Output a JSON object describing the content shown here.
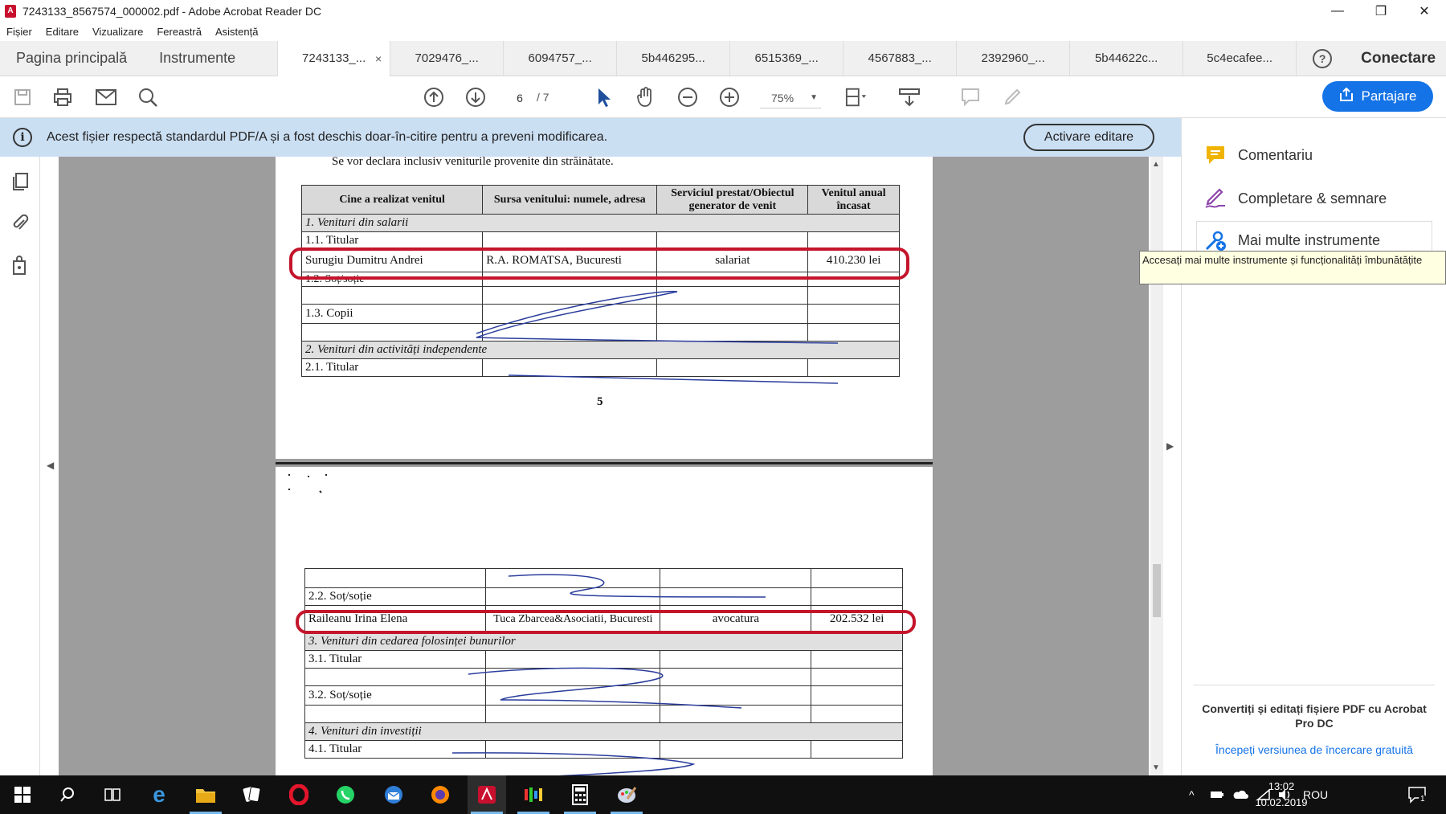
{
  "window": {
    "title": "7243133_8567574_000002.pdf - Adobe Acrobat Reader DC",
    "app_icon_glyph": "A",
    "minimize": "—",
    "restore": "❐",
    "close": "✕"
  },
  "menu": [
    "Fișier",
    "Editare",
    "Vizualizare",
    "Fereastră",
    "Asistență"
  ],
  "tabs": {
    "home": "Pagina principală",
    "tools": "Instrumente",
    "documents": [
      "7243133_...",
      "7029476_...",
      "6094757_...",
      "5b446295...",
      "6515369_...",
      "4567883_...",
      "2392960_...",
      "5b44622c...",
      "5c4ecafee..."
    ],
    "active_index": 0,
    "close_glyph": "×",
    "help": "?",
    "connect": "Conectare"
  },
  "toolbar": {
    "page_current": "6",
    "page_total": "/ 7",
    "zoom": "75%",
    "share_label": "Partajare",
    "icons": [
      "save-icon",
      "print-icon",
      "email-icon",
      "search-icon",
      "prev-page-icon",
      "next-page-icon",
      "select-tool-icon",
      "hand-tool-icon",
      "zoom-out-icon",
      "zoom-in-icon",
      "fit-page-icon",
      "scroll-mode-icon",
      "comment-icon",
      "highlight-icon"
    ]
  },
  "infobar": {
    "message": "Acest fișier respectă standardul PDF/A și a fost deschis doar-în-citire pentru a preveni modificarea.",
    "button": "Activare editare"
  },
  "document": {
    "page1": {
      "intro": "Se vor declara inclusiv veniturile provenite din străinătate.",
      "headers": [
        "Cine a realizat venitul",
        "Sursa venitului: numele, adresa",
        "Serviciul prestat/Obiectul generator de venit",
        "Venitul anual încasat"
      ],
      "rows": [
        {
          "type": "section",
          "text": "1. Venituri din salarii"
        },
        {
          "type": "row",
          "cells": [
            "1.1. Titular",
            "",
            "",
            ""
          ]
        },
        {
          "type": "row",
          "cells": [
            "Surugiu Dumitru Andrei",
            "R.A. ROMATSA, Bucuresti",
            "salariat",
            "410.230 lei"
          ]
        },
        {
          "type": "row",
          "cells": [
            "1.2. Soț/soție",
            "",
            "",
            ""
          ]
        },
        {
          "type": "row",
          "cells": [
            "",
            "",
            "",
            ""
          ]
        },
        {
          "type": "row",
          "cells": [
            "1.3. Copii",
            "",
            "",
            ""
          ]
        },
        {
          "type": "row",
          "cells": [
            "",
            "",
            "",
            ""
          ]
        },
        {
          "type": "section",
          "text": "2. Venituri din activități independente"
        },
        {
          "type": "row",
          "cells": [
            "2.1. Titular",
            "",
            "",
            ""
          ]
        }
      ],
      "page_number": "5"
    },
    "page2": {
      "rows": [
        {
          "type": "row",
          "cells": [
            "",
            "",
            "",
            ""
          ]
        },
        {
          "type": "row",
          "cells": [
            "2.2. Soț/soție",
            "",
            "",
            ""
          ]
        },
        {
          "type": "row",
          "cells": [
            "Raileanu Irina Elena",
            "Tuca Zbarcea&Asociatii, Bucuresti",
            "avocatura",
            "202.532 lei"
          ]
        },
        {
          "type": "section",
          "text": "3. Venituri din cedarea folosinței bunurilor"
        },
        {
          "type": "row",
          "cells": [
            "3.1. Titular",
            "",
            "",
            ""
          ]
        },
        {
          "type": "row",
          "cells": [
            "",
            "",
            "",
            ""
          ]
        },
        {
          "type": "row",
          "cells": [
            "3.2. Soț/soție",
            "",
            "",
            ""
          ]
        },
        {
          "type": "row",
          "cells": [
            "",
            "",
            "",
            ""
          ]
        },
        {
          "type": "section",
          "text": "4. Venituri din investiții"
        },
        {
          "type": "row",
          "cells": [
            "4.1. Titular",
            "",
            "",
            ""
          ]
        }
      ]
    }
  },
  "right_panel": {
    "items": [
      {
        "label": "Comentariu",
        "icon": "comment-icon",
        "color": "#f0b400"
      },
      {
        "label": "Completare & semnare",
        "icon": "fill-sign-icon",
        "color": "#8e44ad"
      },
      {
        "label": "Mai multe instrumente",
        "icon": "more-tools-icon",
        "color": "#1473e6"
      }
    ],
    "tooltip": "Accesați mai multe instrumente și funcționalități îmbunătățite",
    "promo": "Convertiți și editați fișiere PDF cu Acrobat Pro DC",
    "promo_link": "Începeți versiunea de încercare gratuită"
  },
  "taskbar": {
    "apps": [
      "windows-start-icon",
      "search-icon",
      "task-view-icon",
      "edge-icon",
      "file-explorer-icon",
      "solitaire-icon",
      "opera-icon",
      "whatsapp-icon",
      "thunderbird-icon",
      "firefox-icon",
      "acrobat-icon",
      "media-icon",
      "calculator-icon",
      "paint-icon"
    ],
    "language": "ROU",
    "time": "13:02",
    "date": "10.02.2019",
    "notification_count": "1"
  },
  "colors": {
    "accent_blue": "#1473e6",
    "infobar_bg": "#cbdff3",
    "annotation_red": "#c4152b",
    "acrobat_red": "#c8102e"
  }
}
